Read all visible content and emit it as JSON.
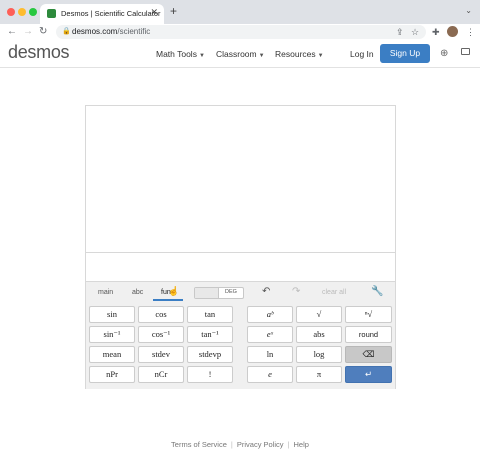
{
  "browser": {
    "tab_title": "Desmos | Scientific Calculator",
    "tab_close": "✕",
    "new_tab": "+",
    "tab_menu": "⌄",
    "url_domain": "desmos.com",
    "url_path": "/scientific",
    "nav": {
      "back": "←",
      "forward": "→",
      "reload": "↻"
    },
    "lock": "🔒",
    "icons": {
      "share": "⇪",
      "bookmark": "☆",
      "extensions": "✚",
      "menu": "⋮"
    }
  },
  "header": {
    "logo": "desmos",
    "nav_items": [
      "Math Tools",
      "Classroom",
      "Resources"
    ],
    "caret": "▼",
    "login": "Log In",
    "signup": "Sign Up",
    "globe": "⊕"
  },
  "keypad": {
    "tabs": [
      "main",
      "abc",
      "func"
    ],
    "active_tab": "func",
    "cursor": "☝",
    "angle_toggle": "DEG",
    "undo": "↶",
    "redo": "↷",
    "clear_all": "clear all",
    "wrench": "🔧",
    "left_keys": [
      [
        "sin",
        "cos",
        "tan"
      ],
      [
        "sin⁻¹",
        "cos⁻¹",
        "tan⁻¹"
      ],
      [
        "mean",
        "stdev",
        "stdevp"
      ],
      [
        "nPr",
        "nCr",
        "!"
      ]
    ],
    "right_keys": [
      [
        "aᵇ",
        "√",
        "ⁿ√"
      ],
      [
        "eˣ",
        "abs",
        "round"
      ],
      [
        "ln",
        "log",
        "⌫"
      ],
      [
        "e",
        "π",
        "↵"
      ]
    ]
  },
  "footer": {
    "links": [
      "Terms of Service",
      "Privacy Policy",
      "Help"
    ],
    "separator": "|"
  },
  "colors": {
    "accent": "#3b7ec4",
    "enter_key": "#4f7ebd",
    "backspace_key": "#c8c8c8"
  }
}
